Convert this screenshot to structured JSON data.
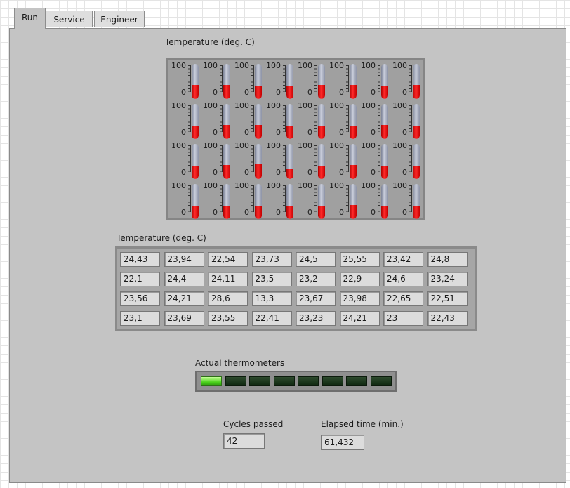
{
  "tabs": [
    {
      "label": "Run",
      "active": true
    },
    {
      "label": "Service",
      "active": false
    },
    {
      "label": "Engineer",
      "active": false
    }
  ],
  "thermometer_graph": {
    "title": "Temperature (deg. C)",
    "scale_max_label": "100",
    "scale_min_label": "0",
    "scale_max": 100,
    "scale_min": 0
  },
  "temperature_table": {
    "title": "Temperature (deg. C)",
    "rows": [
      [
        "24,43",
        "23,94",
        "22,54",
        "23,73",
        "24,5",
        "25,55",
        "23,42",
        "24,8"
      ],
      [
        "22,1",
        "24,4",
        "24,11",
        "23,5",
        "23,2",
        "22,9",
        "24,6",
        "23,24"
      ],
      [
        "23,56",
        "24,21",
        "28,6",
        "13,3",
        "23,67",
        "23,98",
        "22,65",
        "22,51"
      ],
      [
        "23,1",
        "23,69",
        "23,55",
        "22,41",
        "23,23",
        "24,21",
        "23",
        "22,43"
      ]
    ]
  },
  "thermometers_indicator": {
    "title": "Actual thermometers",
    "leds": [
      true,
      false,
      false,
      false,
      false,
      false,
      false,
      false
    ]
  },
  "cycles": {
    "label": "Cycles passed",
    "value": "42"
  },
  "elapsed": {
    "label": "Elapsed time (min.)",
    "value": "61,432"
  },
  "colors": {
    "fill": "#e00000",
    "led_on": "#4cd21c",
    "panel": "#c4c4c4"
  }
}
